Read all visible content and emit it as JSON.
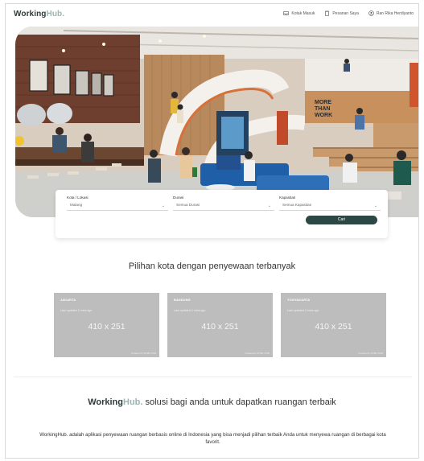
{
  "header": {
    "logo_main": "Working",
    "logo_accent": "Hub.",
    "nav": [
      {
        "label": "Kotak Masuk",
        "icon": "inbox-icon"
      },
      {
        "label": "Pesanan Saya",
        "icon": "clipboard-icon"
      },
      {
        "label": "Ran Rika Herdiyanto",
        "icon": "user-icon"
      }
    ]
  },
  "hero": {
    "wall_text": [
      "MORE",
      "THAN",
      "WORK"
    ]
  },
  "search": {
    "kota": {
      "label": "Kota / Lokasi",
      "value": "Malang"
    },
    "durasi": {
      "label": "Durasi",
      "value": "Semua Durasi"
    },
    "kapasitas": {
      "label": "Kapasitas",
      "value": "Semua Kapasitas"
    },
    "button": "Cari"
  },
  "cities": {
    "title": "Pilihan kota dengan penyewaan terbanyak",
    "items": [
      {
        "name": "JAKARTA",
        "updated": "Last updated 3 mins ago",
        "placeholder": "410 x 251",
        "powered": "Powered by HTML.COM"
      },
      {
        "name": "BANDUNG",
        "updated": "Last updated 3 mins ago",
        "placeholder": "410 x 251",
        "powered": "Powered by HTML.COM"
      },
      {
        "name": "YOGYAKARTA",
        "updated": "Last updated 3 mins ago",
        "placeholder": "410 x 251",
        "powered": "Powered by HTML.COM"
      }
    ]
  },
  "about": {
    "brand_main": "Working",
    "brand_accent": "Hub.",
    "title_rest": " solusi bagi anda untuk dapatkan ruangan terbaik",
    "description": "WorkingHub. adalah aplikasi penyewaan ruangan berbasis online di Indonesia yang bisa menjadi pilihan terbaik Anda untuk menyewa ruangan di berbagai kota favorit."
  },
  "colors": {
    "brand_dark": "#2c3b3a",
    "brand_light": "#9db4b2",
    "button": "#2d4745",
    "placeholder_grey": "#bdbdbd"
  }
}
